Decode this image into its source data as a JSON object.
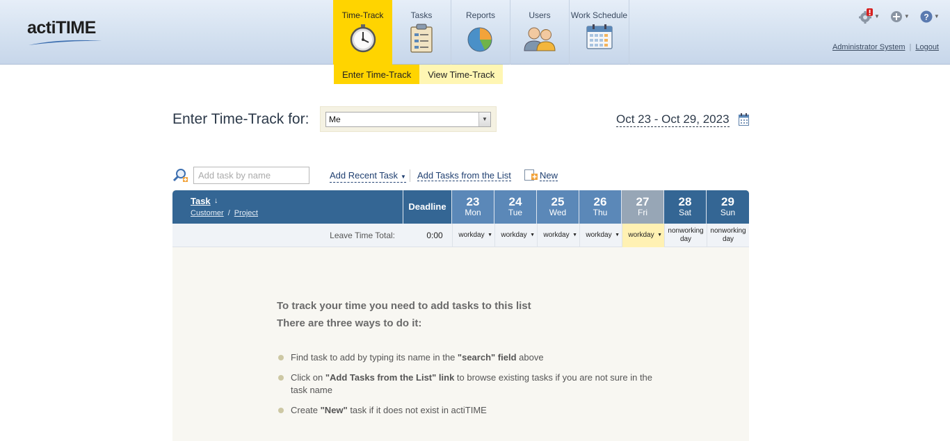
{
  "app": {
    "logo": "actiTIME"
  },
  "nav": {
    "items": [
      {
        "label": "Time-Track"
      },
      {
        "label": "Tasks"
      },
      {
        "label": "Reports"
      },
      {
        "label": "Users"
      },
      {
        "label": "Work Schedule"
      }
    ],
    "active": "Time-Track"
  },
  "subnav": {
    "enter": "Enter Time-Track",
    "view": "View Time-Track"
  },
  "user": {
    "name": "Administrator System",
    "logout": "Logout"
  },
  "title": {
    "label": "Enter Time-Track for:",
    "selected_user": "Me"
  },
  "period": {
    "range": "Oct 23 - Oct 29, 2023"
  },
  "toolbar": {
    "search_placeholder": "Add task by name",
    "add_recent": "Add Recent Task",
    "add_from_list": "Add Tasks from the List",
    "new_label": "New"
  },
  "table": {
    "task_header": "Task",
    "customer": "Customer",
    "project": "Project",
    "deadline": "Deadline",
    "days": [
      {
        "num": "23",
        "name": "Mon"
      },
      {
        "num": "24",
        "name": "Tue"
      },
      {
        "num": "25",
        "name": "Wed"
      },
      {
        "num": "26",
        "name": "Thu"
      },
      {
        "num": "27",
        "name": "Fri"
      },
      {
        "num": "28",
        "name": "Sat"
      },
      {
        "num": "29",
        "name": "Sun"
      }
    ],
    "leave_label": "Leave Time Total:",
    "leave_total": "0:00",
    "day_types": [
      "workday",
      "workday",
      "workday",
      "workday",
      "workday",
      "nonworking day",
      "nonworking day"
    ]
  },
  "empty": {
    "title1": "To track your time you need to add tasks to this list",
    "title2": "There are three ways to do it:",
    "tip1": {
      "a": "Find task to add by typing its name in the ",
      "b": "\"search\" field",
      "c": " above"
    },
    "tip2": {
      "a": "Click on ",
      "b": "\"Add Tasks from the List\" link",
      "c": " to browse existing tasks if you are not sure in the task name"
    },
    "tip3": {
      "a": "Create ",
      "b": "\"New\"",
      "c": " task if it does not exist in actiTIME"
    }
  },
  "colors": {
    "accent_yellow": "#ffd400",
    "header_blue": "#346694",
    "weekday_blue": "#5b88b8",
    "today_gray": "#97a6b6"
  }
}
